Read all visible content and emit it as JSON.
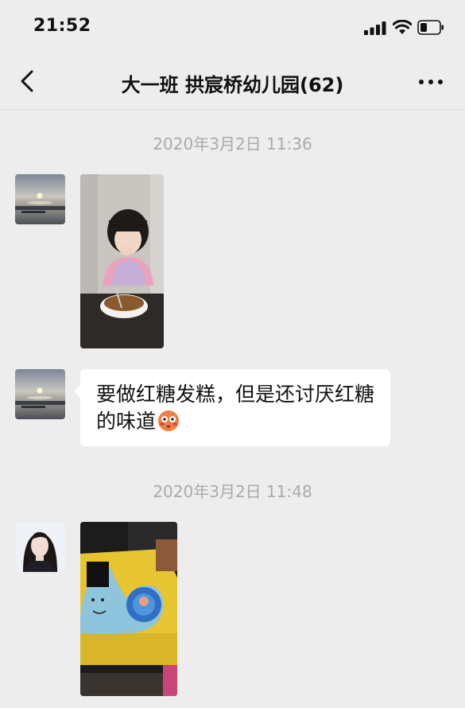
{
  "status": {
    "time": "21:52"
  },
  "nav": {
    "title": "大一班  拱宸桥幼儿园(62)"
  },
  "messages": [
    {
      "timestamp": "2020年3月2日 11:36"
    },
    {
      "text": "要做红糖发糕，但是还讨厌红糖的味道",
      "emoji": "flushed-face-emoji"
    },
    {
      "timestamp": "2020年3月2日 11:48"
    }
  ]
}
